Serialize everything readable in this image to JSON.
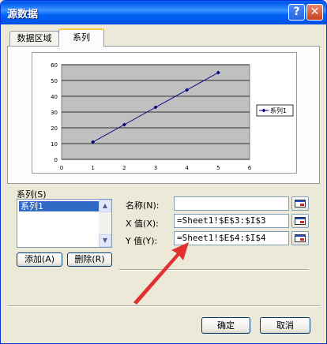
{
  "window": {
    "title": "源数据",
    "help_glyph": "?",
    "close_glyph": "✕"
  },
  "tabs": [
    {
      "label": "数据区域",
      "active": false
    },
    {
      "label": "系列",
      "active": true
    }
  ],
  "chart_data": {
    "type": "line",
    "x": [
      1,
      2,
      3,
      4,
      5
    ],
    "series": [
      {
        "name": "系列1",
        "values": [
          11,
          22,
          33,
          44,
          55
        ],
        "color": "#000080"
      }
    ],
    "xlim": [
      0,
      6
    ],
    "ylim": [
      0,
      60
    ],
    "x_ticks": [
      "0",
      "1",
      "2",
      "3",
      "4",
      "5",
      "6"
    ],
    "y_ticks": [
      "0",
      "10",
      "20",
      "30",
      "40",
      "50",
      "60"
    ],
    "plot_background": "#C0C0C0",
    "grid": true,
    "legend_position": "right"
  },
  "series_panel": {
    "label": "系列(S)",
    "items": [
      "系列1"
    ],
    "add_label": "添加(A)",
    "delete_label": "删除(R)"
  },
  "fields": {
    "name_label": "名称(N):",
    "name_value": "",
    "x_label": "X 值(X):",
    "x_value": "=Sheet1!$E$3:$I$3",
    "y_label": "Y 值(Y):",
    "y_value": "=Sheet1!$E$4:$I$4"
  },
  "buttons": {
    "ok_label": "确定",
    "cancel_label": "取消"
  },
  "annotation_color": "#E03030"
}
